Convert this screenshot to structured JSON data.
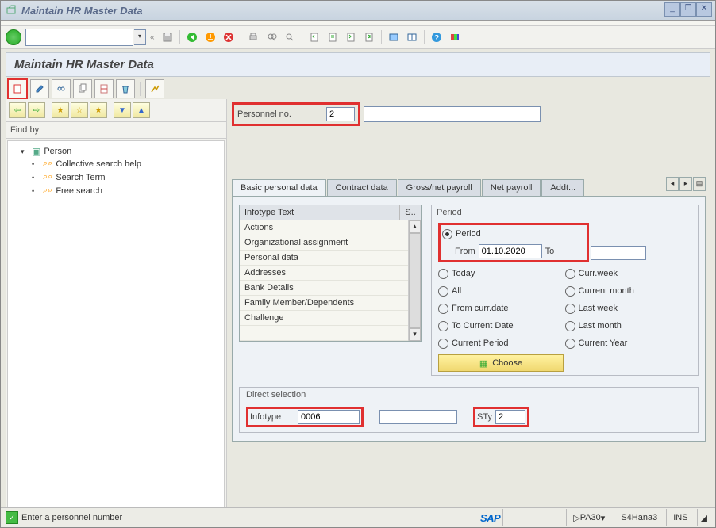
{
  "titlebar": {
    "title": "Maintain HR Master Data"
  },
  "page": {
    "title": "Maintain HR Master Data"
  },
  "tree": {
    "findby": "Find by",
    "root": "Person",
    "items": [
      "Collective search help",
      "Search Term",
      "Free search"
    ]
  },
  "header": {
    "personnel_label": "Personnel no.",
    "personnel_no": "2"
  },
  "tabs": [
    "Basic personal data",
    "Contract data",
    "Gross/net payroll",
    "Net payroll",
    "Addt..."
  ],
  "infotype": {
    "header_text": "Infotype Text",
    "header_s": "S..",
    "rows": [
      "Actions",
      "Organizational assignment",
      "Personal data",
      "Addresses",
      "Bank Details",
      "Family Member/Dependents",
      "Challenge"
    ]
  },
  "period": {
    "title": "Period",
    "opt_period": "Period",
    "from_label": "From",
    "from_value": "01.10.2020",
    "to_label": "To",
    "opts": [
      "Today",
      "Curr.week",
      "All",
      "Current month",
      "From curr.date",
      "Last week",
      "To Current Date",
      "Last month",
      "Current Period",
      "Current Year"
    ],
    "choose": "Choose"
  },
  "direct": {
    "title": "Direct selection",
    "infotype_label": "Infotype",
    "infotype_value": "0006",
    "sty_label": "STy",
    "sty_value": "2"
  },
  "status": {
    "message": "Enter a personnel number",
    "logo": "SAP",
    "tcode": "PA30",
    "system": "S4Hana3",
    "mode": "INS"
  }
}
